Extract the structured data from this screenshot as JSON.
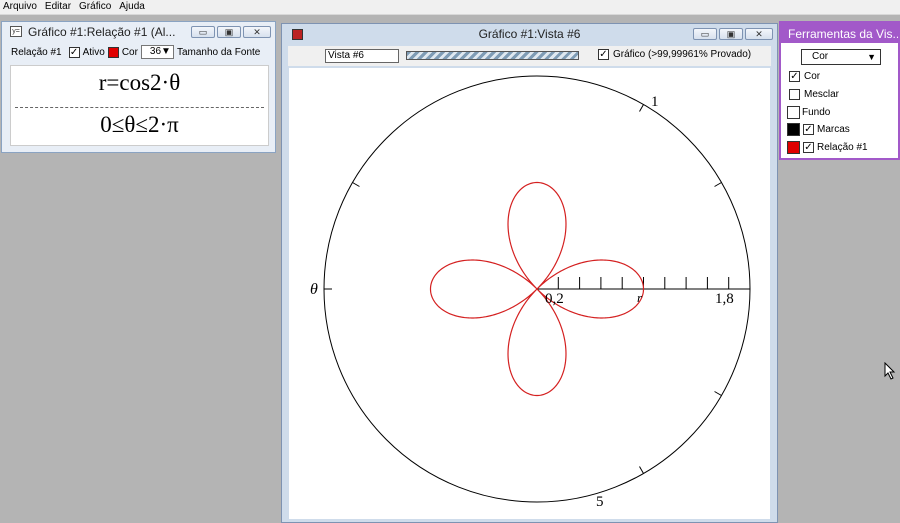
{
  "menu": {
    "items": [
      "Arquivo",
      "Editar",
      "Gráfico",
      "Ajuda"
    ]
  },
  "relation_window": {
    "title": "Gráfico #1:Relação #1 (Al...",
    "relation_label": "Relação #1",
    "active_label": "Ativo",
    "active_checked": true,
    "color_label": "Cor",
    "color": "#e00000",
    "font_size": "36",
    "font_size_label": "Tamanho da Fonte",
    "formula_1": "r=cos2·θ",
    "formula_2": "0≤θ≤2·π"
  },
  "graph_window": {
    "title": "Gráfico #1:Vista #6",
    "view_name": "Vista #6",
    "proof_label": "Gráfico (>99,99961% Provado)",
    "proof_checked": true,
    "curve_color": "#d42020",
    "axis_labels": {
      "top_tick": "1",
      "bottom_tick": "5",
      "theta": "θ",
      "r_start": "0,2",
      "r_end": "1,8",
      "r_axis": "r"
    },
    "polar_curve": "r=cos2·θ",
    "r_range": [
      0,
      2
    ],
    "r_tick_step": 0.2
  },
  "tools_window": {
    "title": "Ferramentas da Vis...",
    "dropdown_value": "Cor",
    "items": [
      {
        "label": "Cor",
        "checked": true
      },
      {
        "label": "Mesclar",
        "checked": false
      },
      {
        "label": "Fundo",
        "swatch": "#ffffff"
      },
      {
        "label": "Marcas",
        "swatch": "#000000",
        "checked": true
      },
      {
        "label": "Relação #1",
        "swatch": "#e00000",
        "checked": true
      }
    ]
  }
}
